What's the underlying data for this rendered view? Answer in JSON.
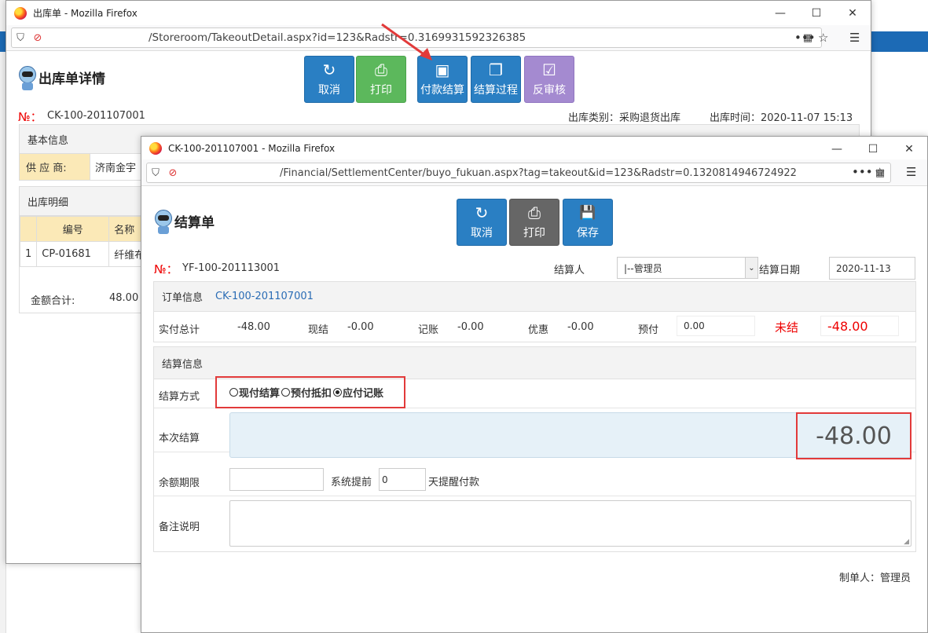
{
  "win1": {
    "title": "出库单 - Mozilla Firefox",
    "url": "/Storeroom/TakeoutDetail.aspx?id=123&Radstr=0.3169931592326385",
    "page_title": "出库单详情",
    "buttons": [
      {
        "label": "取消",
        "icon": "↻"
      },
      {
        "label": "打印",
        "icon": "⎙"
      },
      {
        "label": "付款结算",
        "icon": "▣"
      },
      {
        "label": "结算过程",
        "icon": "❐"
      },
      {
        "label": "反审核",
        "icon": "☑"
      }
    ],
    "no_label": "№：",
    "no_value": "CK-100-201107001",
    "type_label": "出库类别：采购退货出库",
    "time_label": "出库时间：2020-11-07 15:13",
    "basic_info": "基本信息",
    "supplier_label": "供 应 商:",
    "supplier_value": "济南金宇",
    "detail_title": "出库明细",
    "table_headers": [
      "编号",
      "名称"
    ],
    "table_row": {
      "idx": "1",
      "code": "CP-01681",
      "name": "纤维布"
    },
    "total_label": "金额合计:",
    "total_value": "48.00"
  },
  "win2": {
    "title": "CK-100-201107001 - Mozilla Firefox",
    "url": "/Financial/SettlementCenter/buyo_fukuan.aspx?tag=takeout&id=123&Radstr=0.1320814946724922",
    "page_title": "结算单",
    "buttons": [
      {
        "label": "取消",
        "icon": "↻"
      },
      {
        "label": "打印",
        "icon": "⎙"
      },
      {
        "label": "保存",
        "icon": "💾"
      }
    ],
    "no_label": "№：",
    "no_value": "YF-100-201113001",
    "settler_label": "结算人",
    "settler_value": "|--管理员",
    "date_label": "结算日期",
    "date_value": "2020-11-13",
    "order_label": "订单信息",
    "order_link": "CK-100-201107001",
    "summary": {
      "actual_label": "实付总计",
      "actual_value": "-48.00",
      "cash_label": "现结",
      "cash_value": "-0.00",
      "account_label": "记账",
      "account_value": "-0.00",
      "discount_label": "优惠",
      "discount_value": "-0.00",
      "prepay_label": "预付",
      "prepay_value": "0.00",
      "unsettled_label": "未结",
      "unsettled_value": "-48.00"
    },
    "settle_info_title": "结算信息",
    "method_label": "结算方式",
    "methods": [
      "现付结算",
      "预付抵扣",
      "应付记账"
    ],
    "selected_method": 2,
    "current_label": "本次结算",
    "current_value": "-48.00",
    "term_label": "余额期限",
    "remind_prefix": "系统提前",
    "remind_value": "0",
    "remind_suffix": "天提醒付款",
    "remark_label": "备注说明",
    "maker_label": "制单人：管理员"
  },
  "colors": {
    "accent_blue": "#2a7fc3",
    "green": "#5cb85c",
    "purple": "#a48ad0",
    "red": "#e00000"
  }
}
